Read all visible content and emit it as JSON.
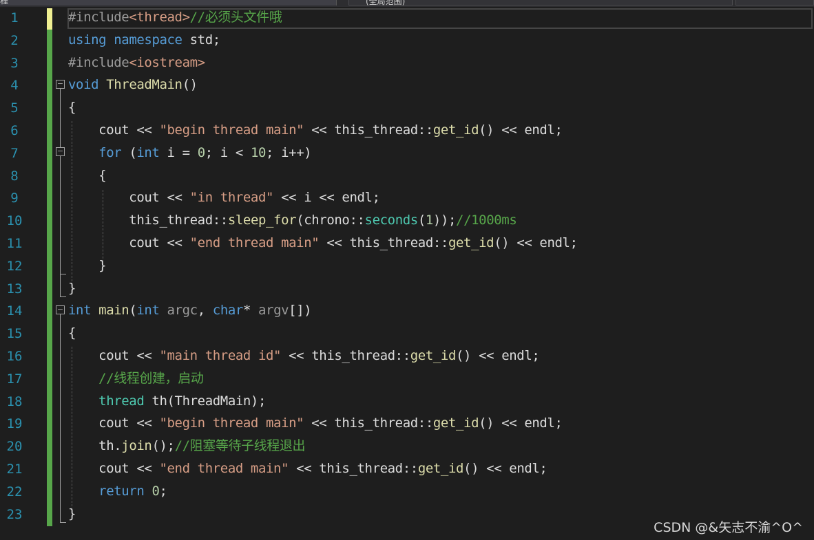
{
  "tabs": {
    "left": "程",
    "right": "(全局范围)"
  },
  "watermark": "CSDN @&矢志不渝^O^",
  "lines": [
    [
      {
        "c": "pp",
        "t": "#include"
      },
      {
        "c": "inc",
        "t": "<thread>"
      },
      {
        "c": "cm",
        "t": "//必须头文件哦"
      }
    ],
    [
      {
        "c": "kw",
        "t": "using"
      },
      {
        "c": "",
        "t": " "
      },
      {
        "c": "kw",
        "t": "namespace"
      },
      {
        "c": "",
        "t": " std;"
      }
    ],
    [
      {
        "c": "pp",
        "t": "#include"
      },
      {
        "c": "inc",
        "t": "<iostream>"
      }
    ],
    [
      {
        "c": "kw",
        "t": "void"
      },
      {
        "c": "",
        "t": " "
      },
      {
        "c": "fn",
        "t": "ThreadMain"
      },
      {
        "c": "",
        "t": "()"
      }
    ],
    [
      {
        "c": "",
        "t": "{"
      }
    ],
    [
      {
        "c": "",
        "t": "    cout << "
      },
      {
        "c": "str",
        "t": "\"begin thread main\""
      },
      {
        "c": "",
        "t": " << this_thread::"
      },
      {
        "c": "fn",
        "t": "get_id"
      },
      {
        "c": "",
        "t": "() << endl;"
      }
    ],
    [
      {
        "c": "",
        "t": "    "
      },
      {
        "c": "kw",
        "t": "for"
      },
      {
        "c": "",
        "t": " ("
      },
      {
        "c": "kw",
        "t": "int"
      },
      {
        "c": "",
        "t": " i = "
      },
      {
        "c": "num",
        "t": "0"
      },
      {
        "c": "",
        "t": "; i < "
      },
      {
        "c": "num",
        "t": "10"
      },
      {
        "c": "",
        "t": "; i++)"
      }
    ],
    [
      {
        "c": "",
        "t": "    {"
      }
    ],
    [
      {
        "c": "",
        "t": "        cout << "
      },
      {
        "c": "str",
        "t": "\"in thread\""
      },
      {
        "c": "",
        "t": " << i << endl;"
      }
    ],
    [
      {
        "c": "",
        "t": "        this_thread::"
      },
      {
        "c": "fn",
        "t": "sleep_for"
      },
      {
        "c": "",
        "t": "(chrono::"
      },
      {
        "c": "ty",
        "t": "seconds"
      },
      {
        "c": "",
        "t": "("
      },
      {
        "c": "num",
        "t": "1"
      },
      {
        "c": "",
        "t": "));"
      },
      {
        "c": "cm",
        "t": "//1000ms"
      }
    ],
    [
      {
        "c": "",
        "t": "        cout << "
      },
      {
        "c": "str",
        "t": "\"end thread main\""
      },
      {
        "c": "",
        "t": " << this_thread::"
      },
      {
        "c": "fn",
        "t": "get_id"
      },
      {
        "c": "",
        "t": "() << endl;"
      }
    ],
    [
      {
        "c": "",
        "t": "    }"
      }
    ],
    [
      {
        "c": "",
        "t": "}"
      }
    ],
    [
      {
        "c": "kw",
        "t": "int"
      },
      {
        "c": "",
        "t": " "
      },
      {
        "c": "fn",
        "t": "main"
      },
      {
        "c": "",
        "t": "("
      },
      {
        "c": "kw",
        "t": "int"
      },
      {
        "c": "",
        "t": " "
      },
      {
        "c": "pp",
        "t": "argc"
      },
      {
        "c": "",
        "t": ", "
      },
      {
        "c": "kw",
        "t": "char"
      },
      {
        "c": "",
        "t": "* "
      },
      {
        "c": "pp",
        "t": "argv"
      },
      {
        "c": "",
        "t": "[])"
      }
    ],
    [
      {
        "c": "",
        "t": "{"
      }
    ],
    [
      {
        "c": "",
        "t": "    cout << "
      },
      {
        "c": "str",
        "t": "\"main thread id\""
      },
      {
        "c": "",
        "t": " << this_thread::"
      },
      {
        "c": "fn",
        "t": "get_id"
      },
      {
        "c": "",
        "t": "() << endl;"
      }
    ],
    [
      {
        "c": "",
        "t": "    "
      },
      {
        "c": "cm",
        "t": "//线程创建，启动"
      }
    ],
    [
      {
        "c": "",
        "t": "    "
      },
      {
        "c": "ty",
        "t": "thread"
      },
      {
        "c": "",
        "t": " th(ThreadMain);"
      }
    ],
    [
      {
        "c": "",
        "t": "    cout << "
      },
      {
        "c": "str",
        "t": "\"begin thread main\""
      },
      {
        "c": "",
        "t": " << this_thread::"
      },
      {
        "c": "fn",
        "t": "get_id"
      },
      {
        "c": "",
        "t": "() << endl;"
      }
    ],
    [
      {
        "c": "",
        "t": "    th."
      },
      {
        "c": "fn",
        "t": "join"
      },
      {
        "c": "",
        "t": "();"
      },
      {
        "c": "cm",
        "t": "//阻塞等待子线程退出"
      }
    ],
    [
      {
        "c": "",
        "t": "    cout << "
      },
      {
        "c": "str",
        "t": "\"end thread main\""
      },
      {
        "c": "",
        "t": " << this_thread::"
      },
      {
        "c": "fn",
        "t": "get_id"
      },
      {
        "c": "",
        "t": "() << endl;"
      }
    ],
    [
      {
        "c": "",
        "t": "    "
      },
      {
        "c": "kw",
        "t": "return"
      },
      {
        "c": "",
        "t": " "
      },
      {
        "c": "num",
        "t": "0"
      },
      {
        "c": "",
        "t": ";"
      }
    ],
    [
      {
        "c": "",
        "t": "}"
      }
    ]
  ]
}
